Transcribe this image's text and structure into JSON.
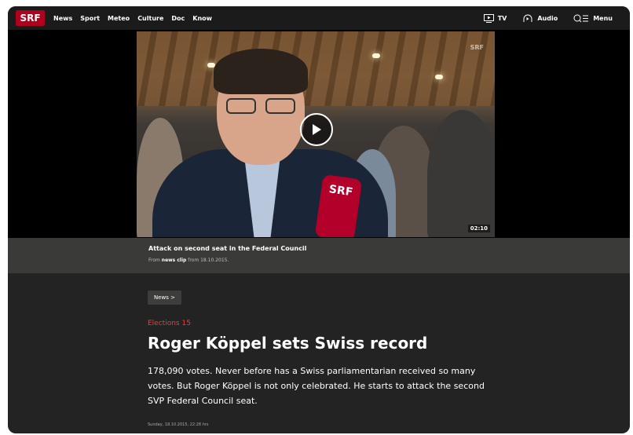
{
  "nav": {
    "logo": "SRF",
    "links": [
      "News",
      "Sport",
      "Meteo",
      "Culture",
      "Doc",
      "Know"
    ],
    "right": [
      {
        "label": "TV",
        "icon": "tv-icon"
      },
      {
        "label": "Audio",
        "icon": "audio-icon"
      },
      {
        "label": "Menu",
        "icon": "search-menu-icon"
      }
    ]
  },
  "video": {
    "watermark": "SRF",
    "mic_label": "SRF",
    "duration": "02:10",
    "play_icon": "play-icon"
  },
  "caption": {
    "title": "Attack on second seat in the Federal Council",
    "from_prefix": "From",
    "source": "news clip",
    "from_suffix": "from 18.10.2015."
  },
  "article": {
    "breadcrumb": "News >",
    "kicker": "Elections 15",
    "headline": "Roger Köppel sets Swiss record",
    "lead": "178,090 votes. Never before has a Swiss parliamentarian received so many votes. But Roger Köppel is not only celebrated. He starts to attack the second SVP Federal Council seat.",
    "date": "Sunday, 18.10.2015, 22:28 hrs"
  },
  "colors": {
    "brand": "#af001e",
    "kicker": "#e8403a",
    "background": "#232323"
  }
}
